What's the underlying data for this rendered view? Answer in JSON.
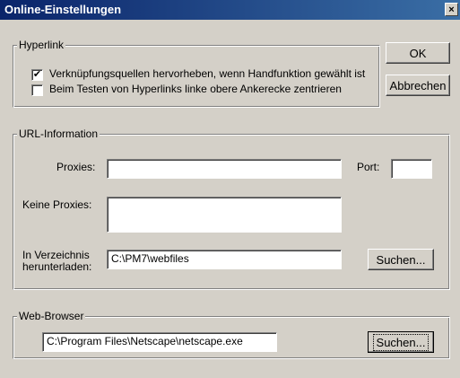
{
  "window": {
    "title": "Online-Einstellungen",
    "close_glyph": "×"
  },
  "hyperlink": {
    "legend": "Hyperlink",
    "options": [
      {
        "label": "Verknüpfungsquellen hervorheben, wenn Handfunktion gewählt ist",
        "checked": true
      },
      {
        "label": "Beim Testen von Hyperlinks linke obere Ankerecke zentrieren",
        "checked": false
      }
    ]
  },
  "buttons": {
    "ok": "OK",
    "cancel": "Abbrechen"
  },
  "url_info": {
    "legend": "URL-Information",
    "proxies_label": "Proxies:",
    "proxies_value": "",
    "port_label": "Port:",
    "port_value": "",
    "no_proxies_label": "Keine Proxies:",
    "no_proxies_value": "",
    "download_label_line1": "In Verzeichnis",
    "download_label_line2": "herunterladen:",
    "download_value": "C:\\PM7\\webfiles",
    "browse_label": "Suchen..."
  },
  "web_browser": {
    "legend": "Web-Browser",
    "path_value": "C:\\Program Files\\Netscape\\netscape.exe",
    "browse_label": "Suchen..."
  },
  "colors": {
    "titlebar_start": "#0a246a",
    "titlebar_end": "#3a6ea5",
    "face": "#d4d0c8"
  }
}
